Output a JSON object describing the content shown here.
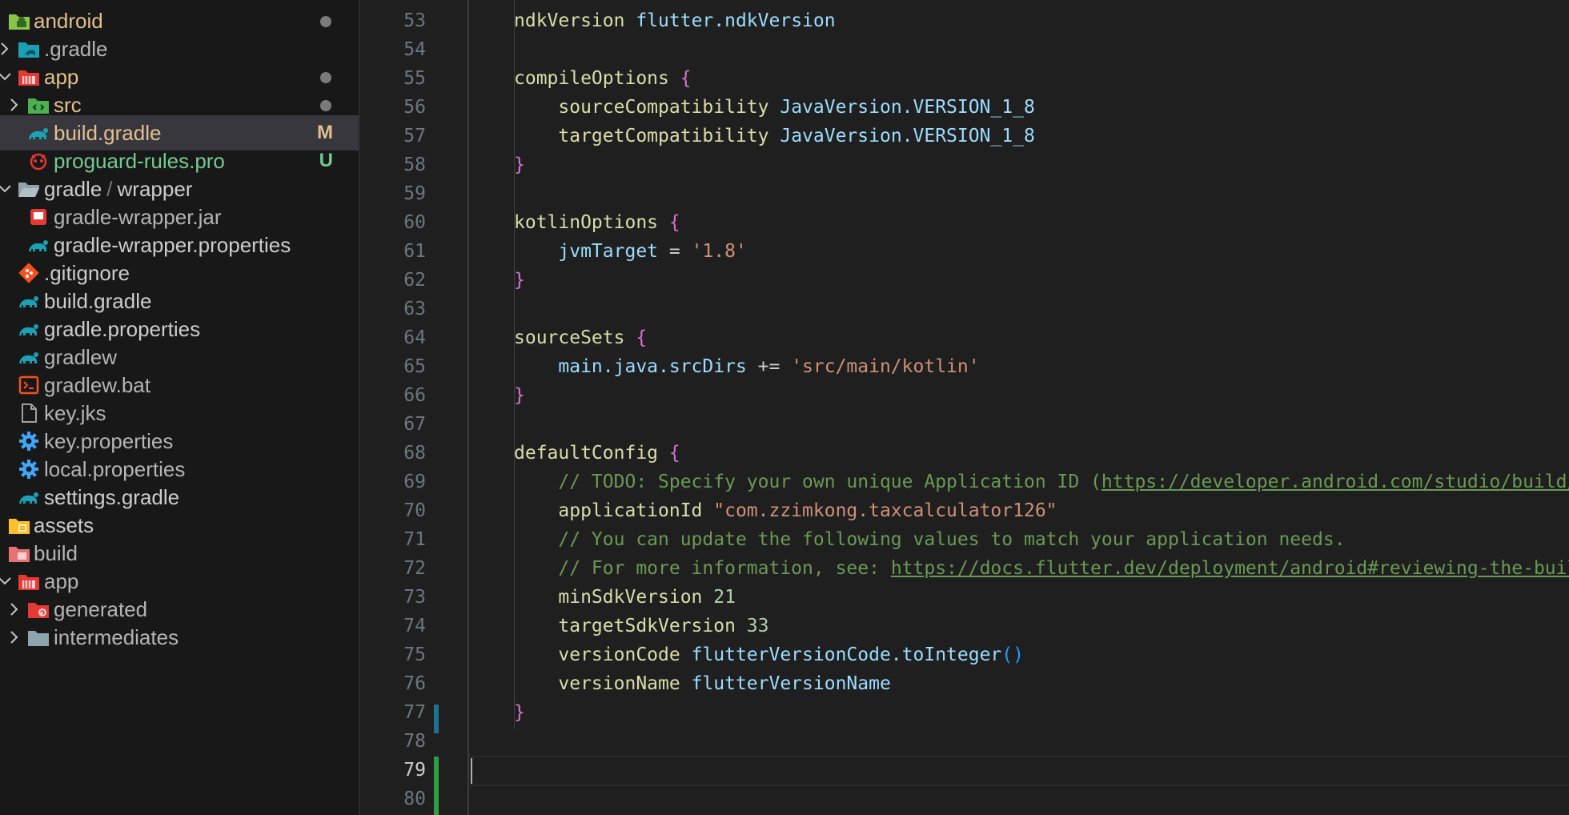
{
  "explorer": {
    "items": [
      {
        "label": "android",
        "status": "",
        "dot": true
      },
      {
        "label": ".gradle",
        "status": "",
        "dot": false
      },
      {
        "label": "app",
        "status": "",
        "dot": true
      },
      {
        "label": "src",
        "status": "",
        "dot": true
      },
      {
        "label": "build.gradle",
        "status": "M",
        "dot": false
      },
      {
        "label": "proguard-rules.pro",
        "status": "U",
        "dot": false
      },
      {
        "label": "gradle",
        "label2": "wrapper",
        "status": "",
        "dot": false
      },
      {
        "label": "gradle-wrapper.jar",
        "status": "",
        "dot": false
      },
      {
        "label": "gradle-wrapper.properties",
        "status": "",
        "dot": false
      },
      {
        "label": ".gitignore",
        "status": "",
        "dot": false
      },
      {
        "label": "build.gradle",
        "status": "",
        "dot": false
      },
      {
        "label": "gradle.properties",
        "status": "",
        "dot": false
      },
      {
        "label": "gradlew",
        "status": "",
        "dot": false
      },
      {
        "label": "gradlew.bat",
        "status": "",
        "dot": false
      },
      {
        "label": "key.jks",
        "status": "",
        "dot": false
      },
      {
        "label": "key.properties",
        "status": "",
        "dot": false
      },
      {
        "label": "local.properties",
        "status": "",
        "dot": false
      },
      {
        "label": "settings.gradle",
        "status": "",
        "dot": false
      },
      {
        "label": "assets",
        "status": "",
        "dot": false
      },
      {
        "label": "build",
        "status": "",
        "dot": false
      },
      {
        "label": "app",
        "status": "",
        "dot": false
      },
      {
        "label": "generated",
        "status": "",
        "dot": false
      },
      {
        "label": "intermediates",
        "status": "",
        "dot": false
      }
    ]
  },
  "editor": {
    "line_numbers": [
      "53",
      "54",
      "55",
      "56",
      "57",
      "58",
      "59",
      "60",
      "61",
      "62",
      "63",
      "64",
      "65",
      "66",
      "67",
      "68",
      "69",
      "70",
      "71",
      "72",
      "73",
      "74",
      "75",
      "76",
      "77",
      "78",
      "79",
      "80"
    ],
    "lines": [
      [
        {
          "t": "ndkVersion ",
          "c": "t-kw"
        },
        {
          "t": "flutter.ndkVersion",
          "c": "t-ident"
        }
      ],
      [],
      [
        {
          "t": "compileOptions ",
          "c": "t-kw"
        },
        {
          "t": "{",
          "c": "t-brace"
        }
      ],
      [
        {
          "t": "    sourceCompatibility ",
          "c": "t-kw"
        },
        {
          "t": "JavaVersion.VERSION_1_8",
          "c": "t-ident"
        }
      ],
      [
        {
          "t": "    targetCompatibility ",
          "c": "t-kw"
        },
        {
          "t": "JavaVersion.VERSION_1_8",
          "c": "t-ident"
        }
      ],
      [
        {
          "t": "}",
          "c": "t-brace"
        }
      ],
      [],
      [
        {
          "t": "kotlinOptions ",
          "c": "t-kw"
        },
        {
          "t": "{",
          "c": "t-brace"
        }
      ],
      [
        {
          "t": "    jvmTarget",
          "c": "t-ident"
        },
        {
          "t": " = ",
          "c": "t-plain"
        },
        {
          "t": "'1.8'",
          "c": "t-str"
        }
      ],
      [
        {
          "t": "}",
          "c": "t-brace"
        }
      ],
      [],
      [
        {
          "t": "sourceSets ",
          "c": "t-kw"
        },
        {
          "t": "{",
          "c": "t-brace"
        }
      ],
      [
        {
          "t": "    main.java.srcDirs",
          "c": "t-ident"
        },
        {
          "t": " += ",
          "c": "t-plain"
        },
        {
          "t": "'src/main/kotlin'",
          "c": "t-str"
        }
      ],
      [
        {
          "t": "}",
          "c": "t-brace"
        }
      ],
      [],
      [
        {
          "t": "defaultConfig ",
          "c": "t-kw"
        },
        {
          "t": "{",
          "c": "t-brace"
        }
      ],
      [
        {
          "t": "    // TODO: Specify your own unique Application ID (",
          "c": "t-comment"
        },
        {
          "t": "https://developer.android.com/studio/build/application-id.html",
          "c": "t-link"
        }
      ],
      [
        {
          "t": "    applicationId ",
          "c": "t-kw"
        },
        {
          "t": "\"com.zzimkong.taxcalculator126\"",
          "c": "t-str"
        }
      ],
      [
        {
          "t": "    // You can update the following values to match your application needs.",
          "c": "t-comment"
        }
      ],
      [
        {
          "t": "    // For more information, see: ",
          "c": "t-comment"
        },
        {
          "t": "https://docs.flutter.dev/deployment/android#reviewing-the-build-configuration",
          "c": "t-link"
        }
      ],
      [
        {
          "t": "    minSdkVersion ",
          "c": "t-kw"
        },
        {
          "t": "21",
          "c": "t-num"
        }
      ],
      [
        {
          "t": "    targetSdkVersion ",
          "c": "t-kw"
        },
        {
          "t": "33",
          "c": "t-num"
        }
      ],
      [
        {
          "t": "    versionCode ",
          "c": "t-kw"
        },
        {
          "t": "flutterVersionCode.toInteger",
          "c": "t-ident"
        },
        {
          "t": "()",
          "c": "t-brace2"
        }
      ],
      [
        {
          "t": "    versionName ",
          "c": "t-kw"
        },
        {
          "t": "flutterVersionName",
          "c": "t-ident"
        }
      ],
      [
        {
          "t": "}",
          "c": "t-brace"
        }
      ],
      [],
      [],
      []
    ]
  },
  "colors": {
    "modified": "#e2c08d",
    "untracked": "#73c991",
    "added_bar": "#2ea043",
    "changed_bar": "#1b81a8"
  }
}
